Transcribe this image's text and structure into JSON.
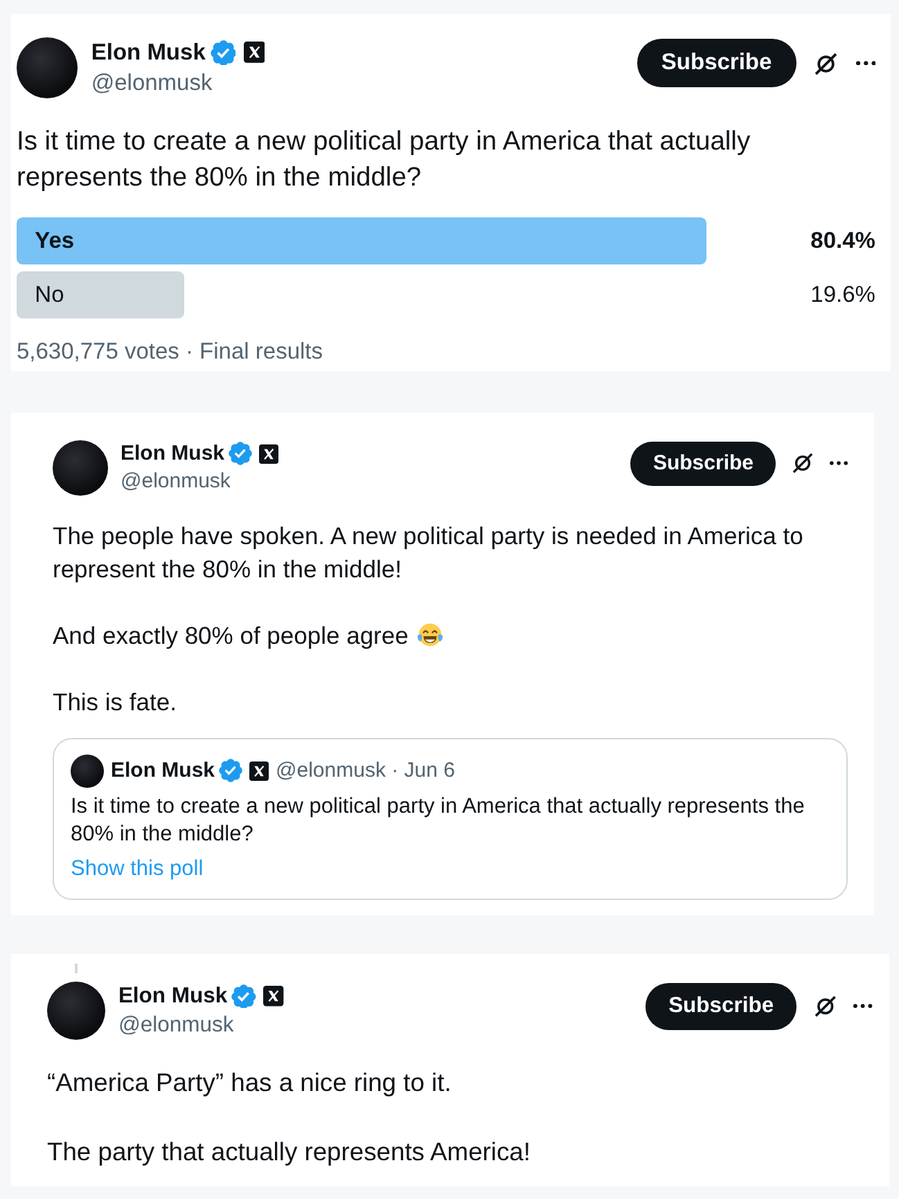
{
  "posts": [
    {
      "in_thread": false,
      "author": {
        "name": "Elon Musk",
        "handle": "@elonmusk",
        "verified": true,
        "affiliate": true
      },
      "subscribe": "Subscribe",
      "paragraphs": [
        {
          "text": "Is it time to create a new political party in America that actually represents the 80% in the middle?",
          "has_emoji": false
        }
      ],
      "poll": {
        "options": [
          {
            "label": "Yes",
            "percent": "80.4%",
            "level": 0.804,
            "leading": true
          },
          {
            "label": "No",
            "percent": "19.6%",
            "level": 0.196,
            "leading": false
          }
        ],
        "summary": "5,630,775 votes · Final results"
      }
    },
    {
      "in_thread": false,
      "author": {
        "name": "Elon Musk",
        "handle": "@elonmusk",
        "verified": true,
        "affiliate": true
      },
      "subscribe": "Subscribe",
      "paragraphs": [
        {
          "text": "The people have spoken. A new political party is needed in America to represent the 80% in the middle!",
          "has_emoji": false
        },
        {
          "text": "And exactly 80% of people agree",
          "has_emoji": true
        },
        {
          "text": "This is fate.",
          "has_emoji": false
        }
      ],
      "quote": {
        "author": {
          "name": "Elon Musk",
          "verified": true,
          "affiliate": true
        },
        "meta": "@elonmusk · Jun 6",
        "text": "Is it time to create a new political party in America that actually represents the 80% in the middle?",
        "link": "Show this poll"
      }
    },
    {
      "in_thread": true,
      "author": {
        "name": "Elon Musk",
        "handle": "@elonmusk",
        "verified": true,
        "affiliate": true
      },
      "subscribe": "Subscribe",
      "paragraphs": [
        {
          "text": "“America Party” has a nice ring to it.",
          "has_emoji": false
        },
        {
          "text": "The party that actually represents America!",
          "has_emoji": false
        }
      ]
    }
  ]
}
